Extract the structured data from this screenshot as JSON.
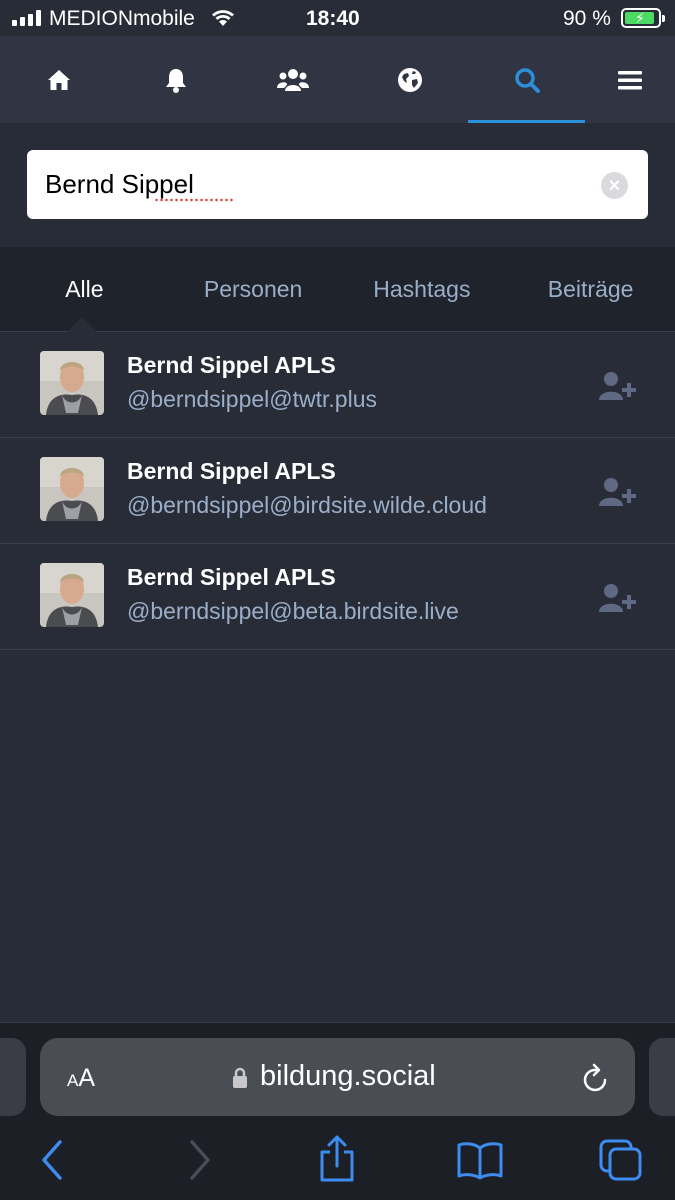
{
  "status_bar": {
    "carrier": "MEDIONmobile",
    "time": "18:40",
    "battery_percent": "90 %",
    "battery_level": 0.9,
    "signal_bars": 4
  },
  "nav": {
    "items": [
      {
        "name": "home",
        "icon": "home-icon"
      },
      {
        "name": "notifications",
        "icon": "bell-icon"
      },
      {
        "name": "local",
        "icon": "users-icon"
      },
      {
        "name": "federated",
        "icon": "globe-icon"
      },
      {
        "name": "search",
        "icon": "search-icon",
        "active": true
      },
      {
        "name": "menu",
        "icon": "hamburger-icon"
      }
    ],
    "accent_color": "#2b90d9"
  },
  "search": {
    "value": "Bernd Sippel",
    "clear_icon": "clear-icon"
  },
  "tabs": [
    {
      "label": "Alle",
      "active": true
    },
    {
      "label": "Personen"
    },
    {
      "label": "Hashtags"
    },
    {
      "label": "Beiträge"
    }
  ],
  "results": [
    {
      "display_name": "Bernd Sippel APLS",
      "acct": "@berndsippel@twtr.plus",
      "action_icon": "add-user-icon"
    },
    {
      "display_name": "Bernd Sippel APLS",
      "acct": "@berndsippel@birdsite.wilde.cloud",
      "action_icon": "add-user-icon"
    },
    {
      "display_name": "Bernd Sippel APLS",
      "acct": "@berndsippel@beta.birdsite.live",
      "action_icon": "add-user-icon"
    }
  ],
  "browser": {
    "text_size_label_small": "A",
    "text_size_label_big": "A",
    "domain": "bildung.social",
    "toolbar_icons": [
      "back-icon",
      "forward-icon",
      "share-icon",
      "bookmarks-icon",
      "tabs-icon"
    ]
  }
}
